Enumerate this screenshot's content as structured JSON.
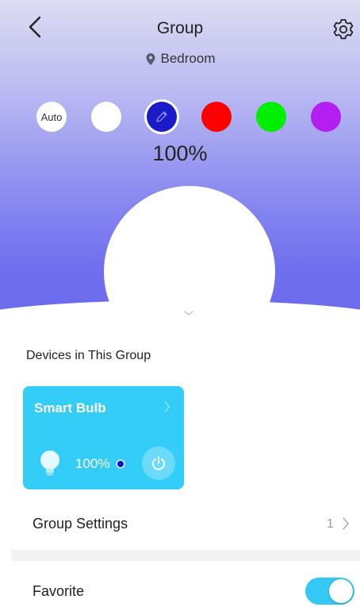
{
  "header": {
    "title": "Group",
    "location": "Bedroom"
  },
  "colors": {
    "accent": "#34cdf8",
    "hero_top": "#dcdcf3",
    "hero_bottom": "#6a6aee",
    "status_dot": "#1010d0"
  },
  "swatches": [
    {
      "label": "Auto",
      "color": "#ffffff"
    },
    {
      "label": "",
      "color": "#ffffff"
    },
    {
      "label": "",
      "color": "#1a1ac8",
      "selected": true,
      "icon": "pencil-icon"
    },
    {
      "label": "",
      "color": "#ff0000"
    },
    {
      "label": "",
      "color": "#00ee00"
    },
    {
      "label": "",
      "color": "#b41ef0"
    }
  ],
  "brightness": "100%",
  "devices_section": {
    "heading": "Devices in This Group",
    "devices": [
      {
        "name": "Smart Bulb",
        "brightness": "100%",
        "icon": "bulb-icon"
      }
    ]
  },
  "group_settings": {
    "label": "Group Settings",
    "count": "1"
  },
  "favorite": {
    "label": "Favorite",
    "enabled": true
  }
}
